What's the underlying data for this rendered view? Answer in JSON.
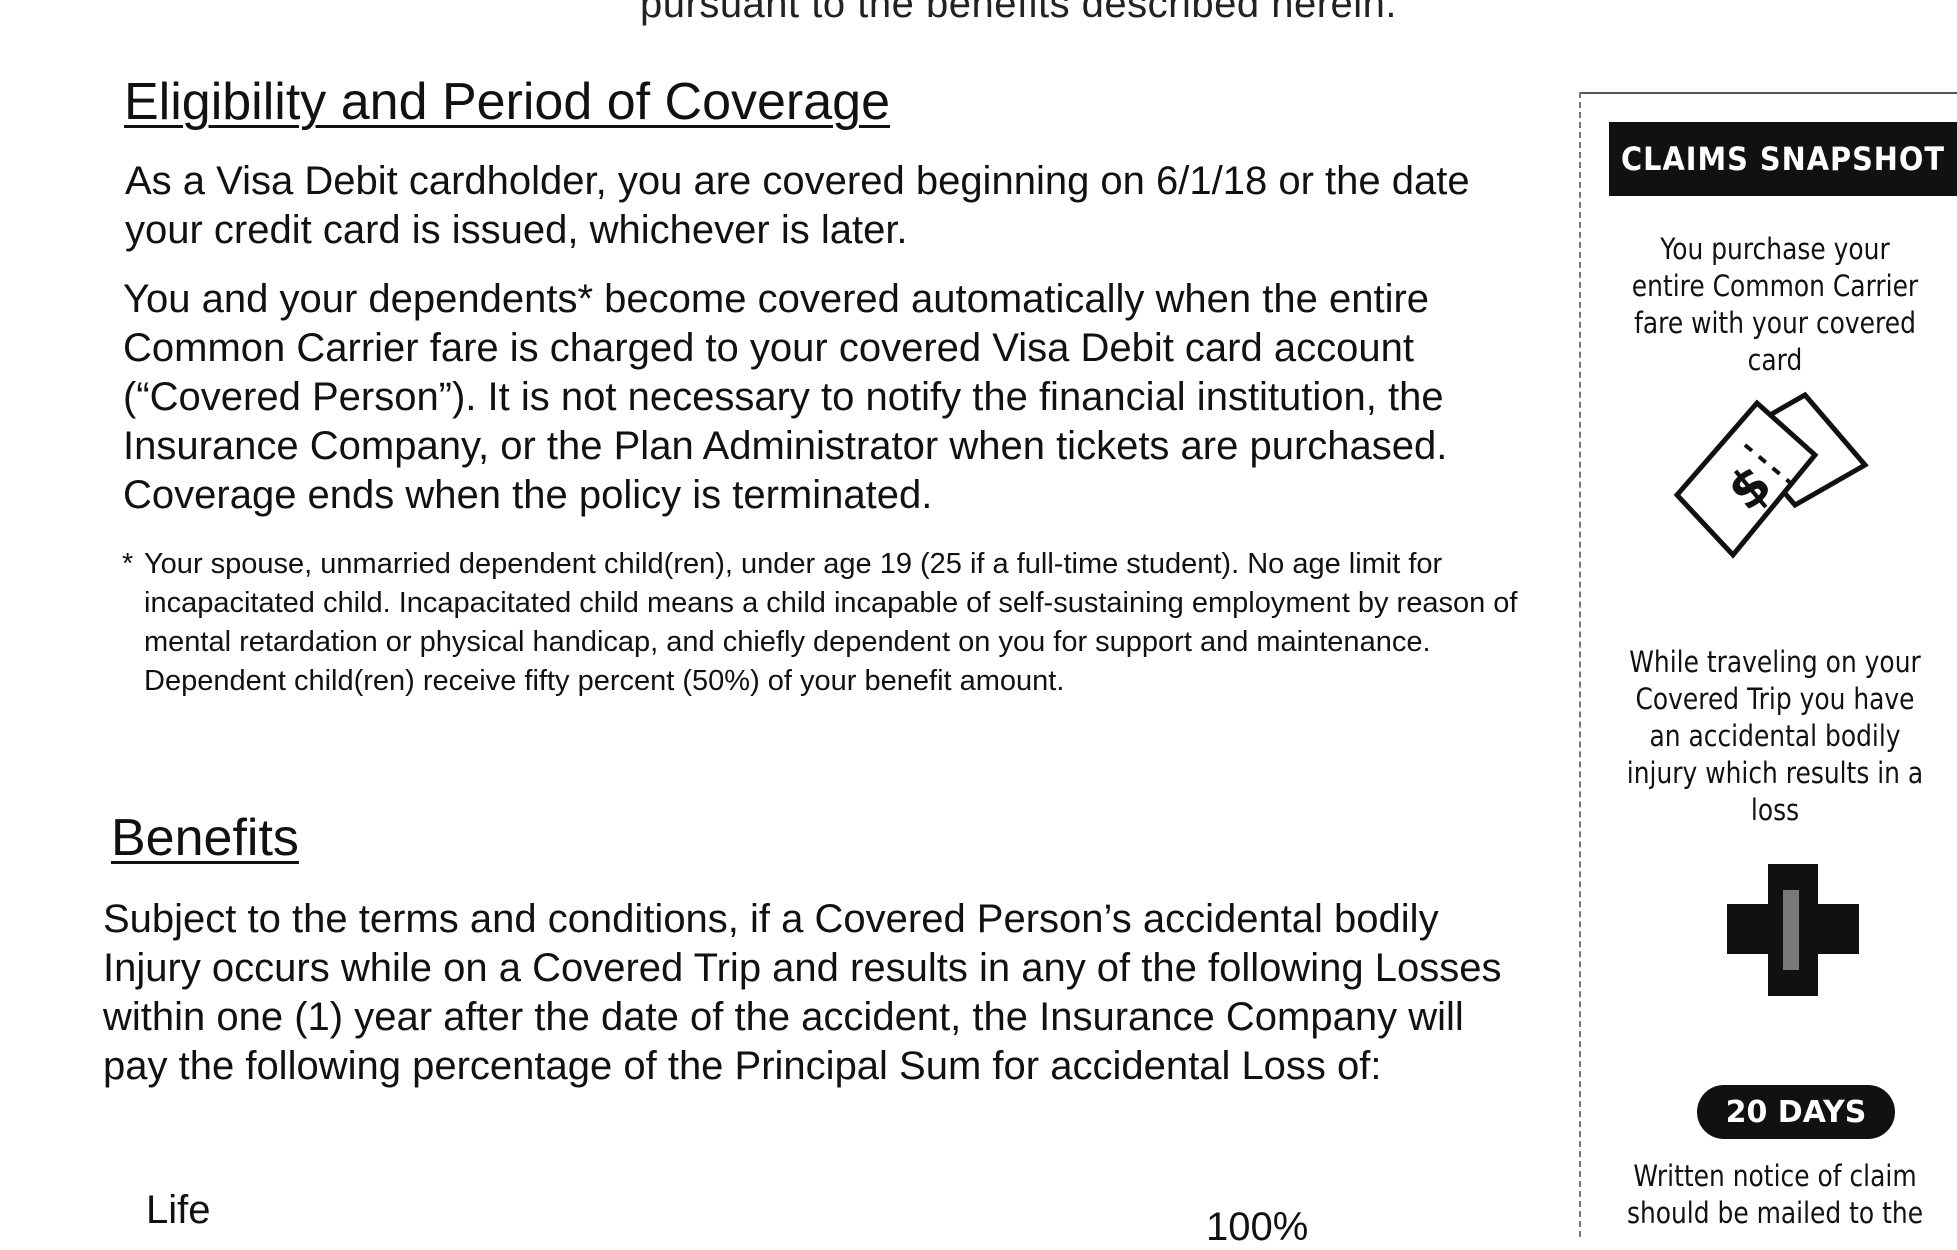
{
  "header": {
    "top_fragment": "pursuant to the benefits described herein."
  },
  "eligibility": {
    "heading": "Eligibility and Period of Coverage",
    "para1": "As a Visa Debit cardholder, you are covered beginning on 6/1/18 or the date your credit card is issued, whichever is later.",
    "para2": "You and your dependents* become covered automatically when the entire Common Carrier fare is charged to your covered Visa Debit card account (“Covered Person”). It is not necessary to notify the financial institution, the Insurance Company, or the Plan Administrator when tickets are purchased. Coverage ends when the policy is terminated.",
    "footnote_marker": "*",
    "footnote": "Your spouse, unmarried dependent child(ren), under age 19 (25 if a full-time student). No age limit for incapacitated child. Incapacitated child means a child incapable of self-sustaining employment by reason of mental retardation or physical handicap, and chiefly dependent on you for support and maintenance. Dependent child(ren) receive fifty percent (50%) of your benefit amount."
  },
  "benefits": {
    "heading": "Benefits",
    "para": "Subject to the terms and conditions, if a Covered Person’s accidental bodily Injury occurs while on a Covered Trip and results in any of the following Losses within one (1) year after the date of the accident, the Insurance Company will pay the following percentage of the Principal Sum for accidental Loss of:",
    "table": [
      {
        "loss": "Life",
        "percent": "100%"
      }
    ]
  },
  "sidebar": {
    "title": "CLAIMS SNAPSHOT",
    "step1": "You purchase your entire Common Carrier fare with your covered card",
    "ticket_symbol": "$",
    "step2": "While traveling on your Covered Trip you have an accidental bodily injury which results in a loss",
    "badge": "20 DAYS",
    "step3": "Written notice of claim should be mailed to the",
    "icons": [
      "ticket-icon",
      "medical-cross-icon"
    ]
  }
}
